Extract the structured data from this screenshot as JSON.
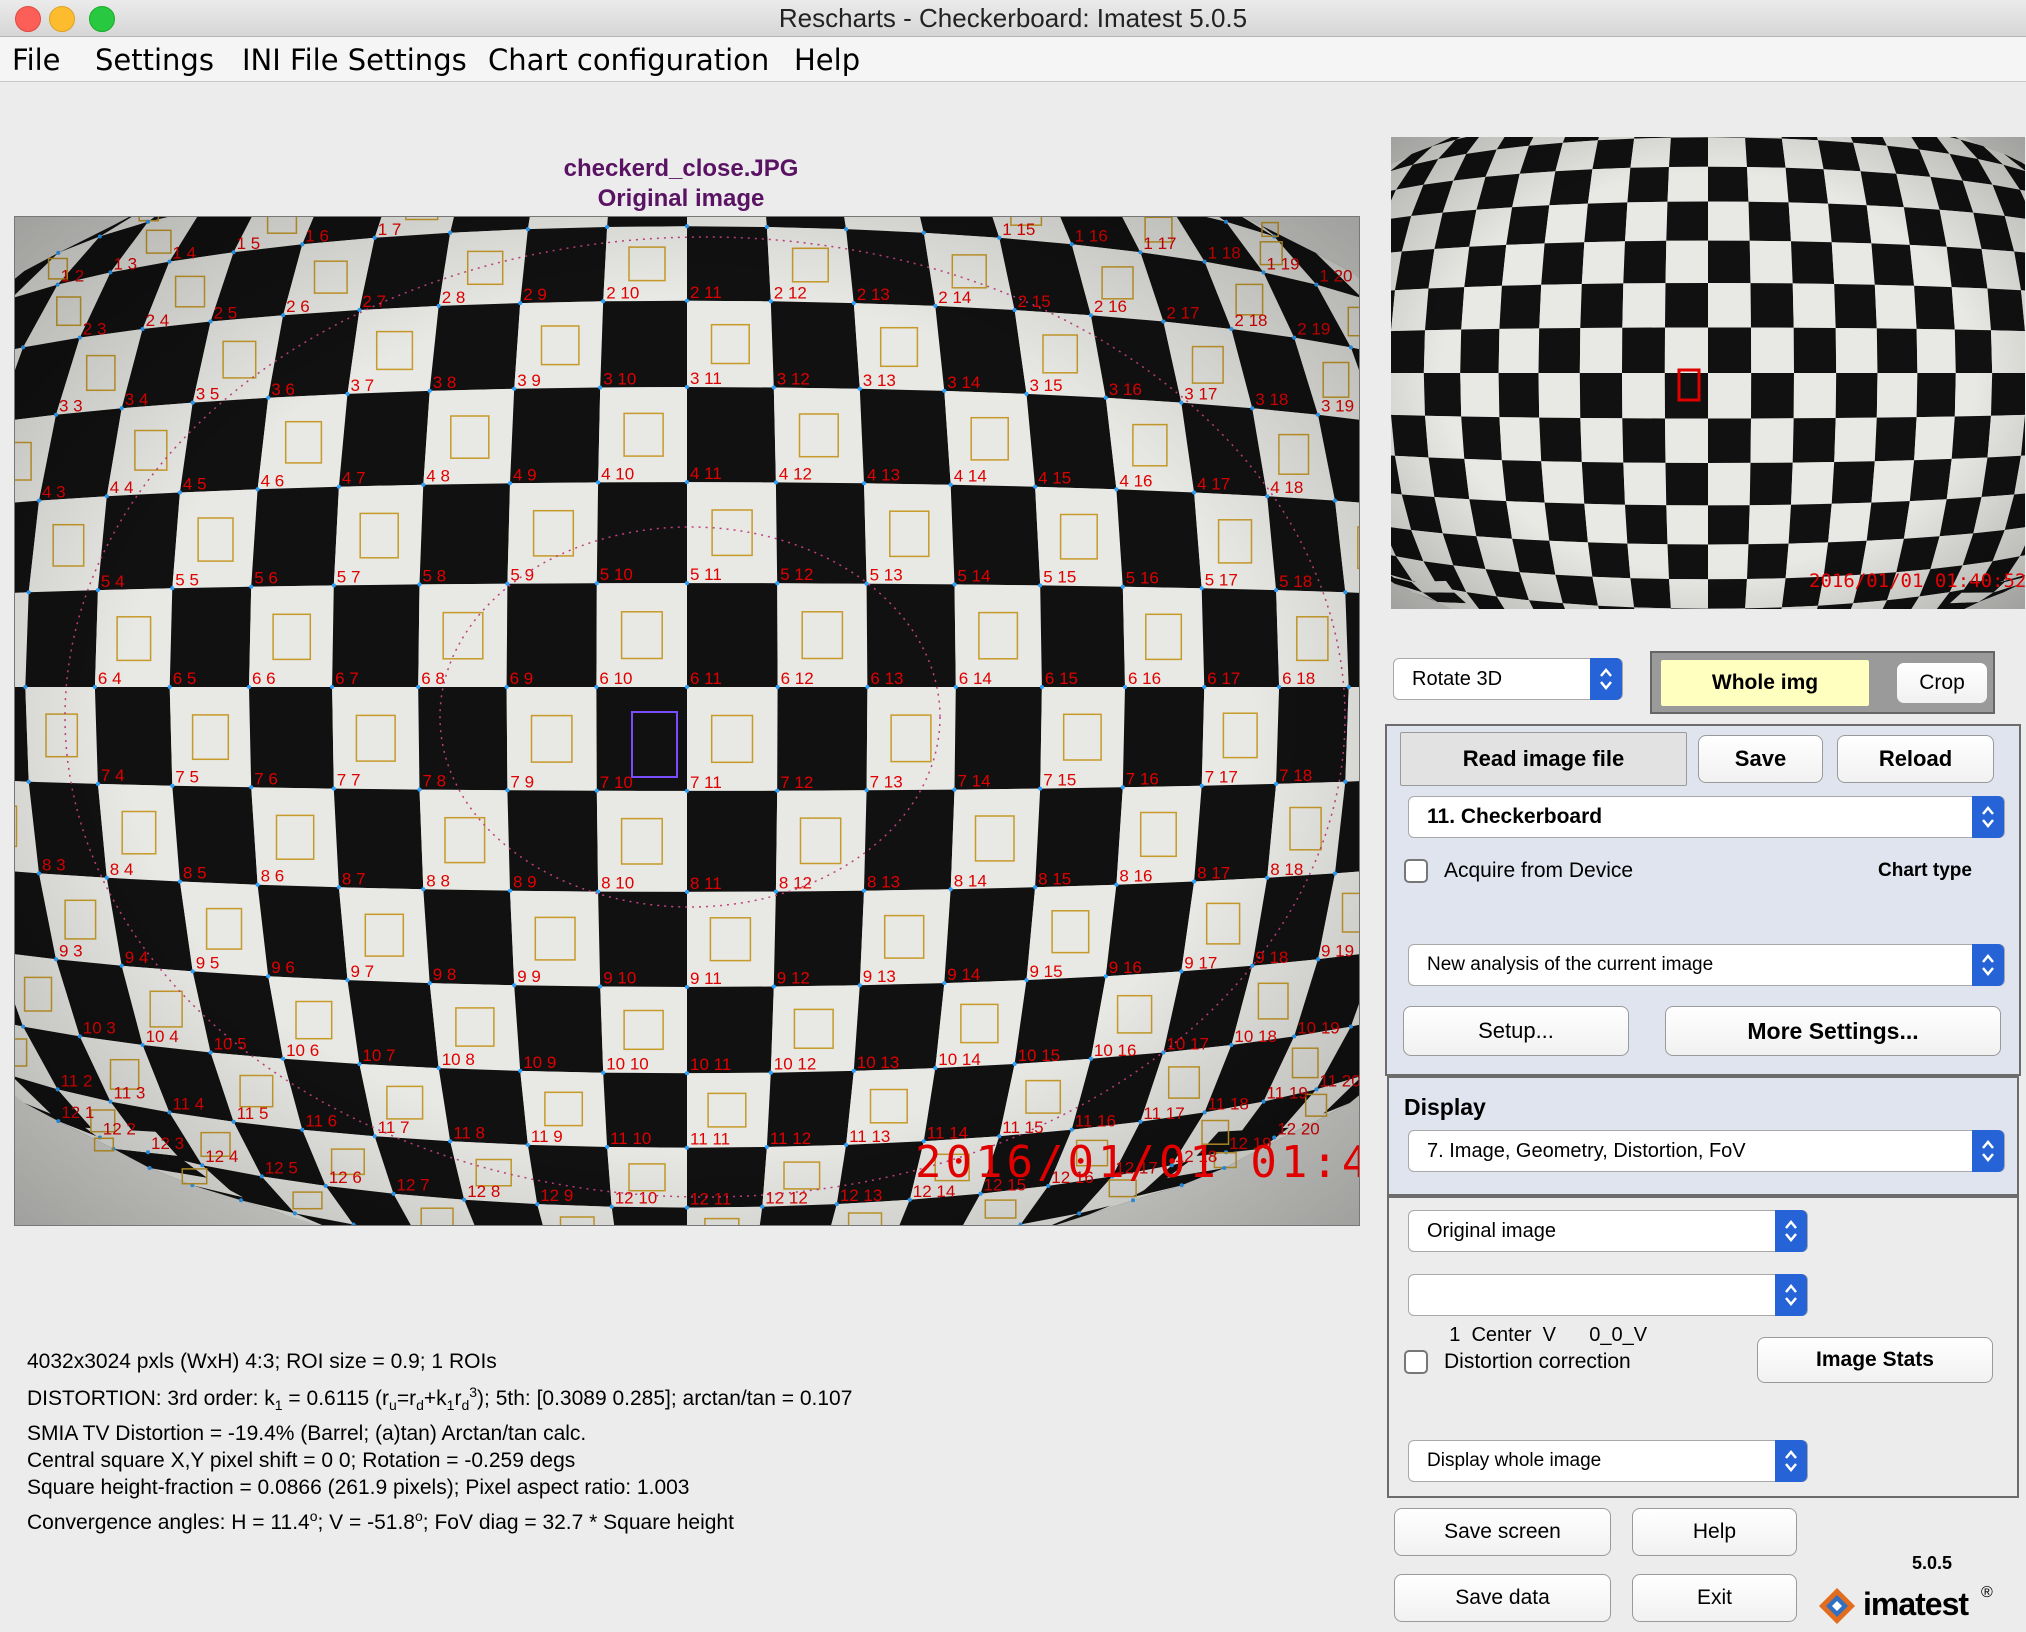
{
  "window": {
    "title": "Rescharts - Checkerboard:  Imatest 5.0.5"
  },
  "menu": [
    "File",
    "Settings",
    "INI File Settings",
    "Chart configuration",
    "Help"
  ],
  "image_panel": {
    "filename": "checkerd_close.JPG",
    "subtitle": "Original image",
    "timestamp_overlay": "2016/01/01 01:40:52"
  },
  "results": {
    "line1": "4032x3024 pxls (WxH) 4:3;    ROI size = 0.9;    1 ROIs",
    "line2_prefix": "DISTORTION:  3rd order:  k",
    "line2_k1_sub": "1",
    "line2_k1_val": " = 0.6115  (r",
    "line2_u": "u",
    "line2_eq": "=r",
    "line2_d1": "d",
    "line2_plus": "+k",
    "line2_1": "1",
    "line2_r": "r",
    "line2_d2": "d",
    "line2_3": "3",
    "line2_close": ");    5th: [0.3089  0.285];    arctan/tan = 0.107",
    "line3": "SMIA TV Distortion = -19.4%  (Barrel; (a)tan)   Arctan/tan calc.",
    "line4": "Central square X,Y pixel shift = 0  0;    Rotation = -0.259 degs",
    "line5": "Square height-fraction = 0.0866  (261.9 pixels);  Pixel aspect ratio: 1.003",
    "line6_a": "Convergence angles:  H = 11.4",
    "line6_deg1": "o",
    "line6_b": ";  V = -51.8",
    "line6_deg2": "o",
    "line6_c": ";    FoV diag = 32.7 * Square height"
  },
  "controls": {
    "rotate_select": "Rotate 3D",
    "whole_img": "Whole img",
    "crop": "Crop",
    "read_image_file": "Read image file",
    "save": "Save",
    "reload": "Reload",
    "chart_select": "11. Checkerboard",
    "acquire_label": "Acquire from Device",
    "acquire_checked": false,
    "chart_type_label": "Chart type",
    "analysis_select": "New analysis of the current image",
    "setup": "Setup...",
    "more_settings": "More Settings...",
    "display_label": "Display",
    "display_select": "7. Image, Geometry, Distortion, FoV",
    "image_select": "Original image",
    "roi_select": "1  Center  V      0_0_V",
    "distortion_label": "Distortion correction",
    "distortion_checked": false,
    "image_stats": "Image Stats",
    "display_whole_select": "Display whole image",
    "save_screen": "Save screen",
    "help": "Help",
    "save_data": "Save data",
    "exit": "Exit",
    "version": "5.0.5",
    "logo_text": "imatest",
    "logo_reg": "®"
  },
  "colors": {
    "caption": "#5a1363",
    "accent_select": "#2663d6",
    "label_red": "#e00000",
    "whole_img_bg": "#ffffc0",
    "panel_bg": "#dfe4ef"
  }
}
